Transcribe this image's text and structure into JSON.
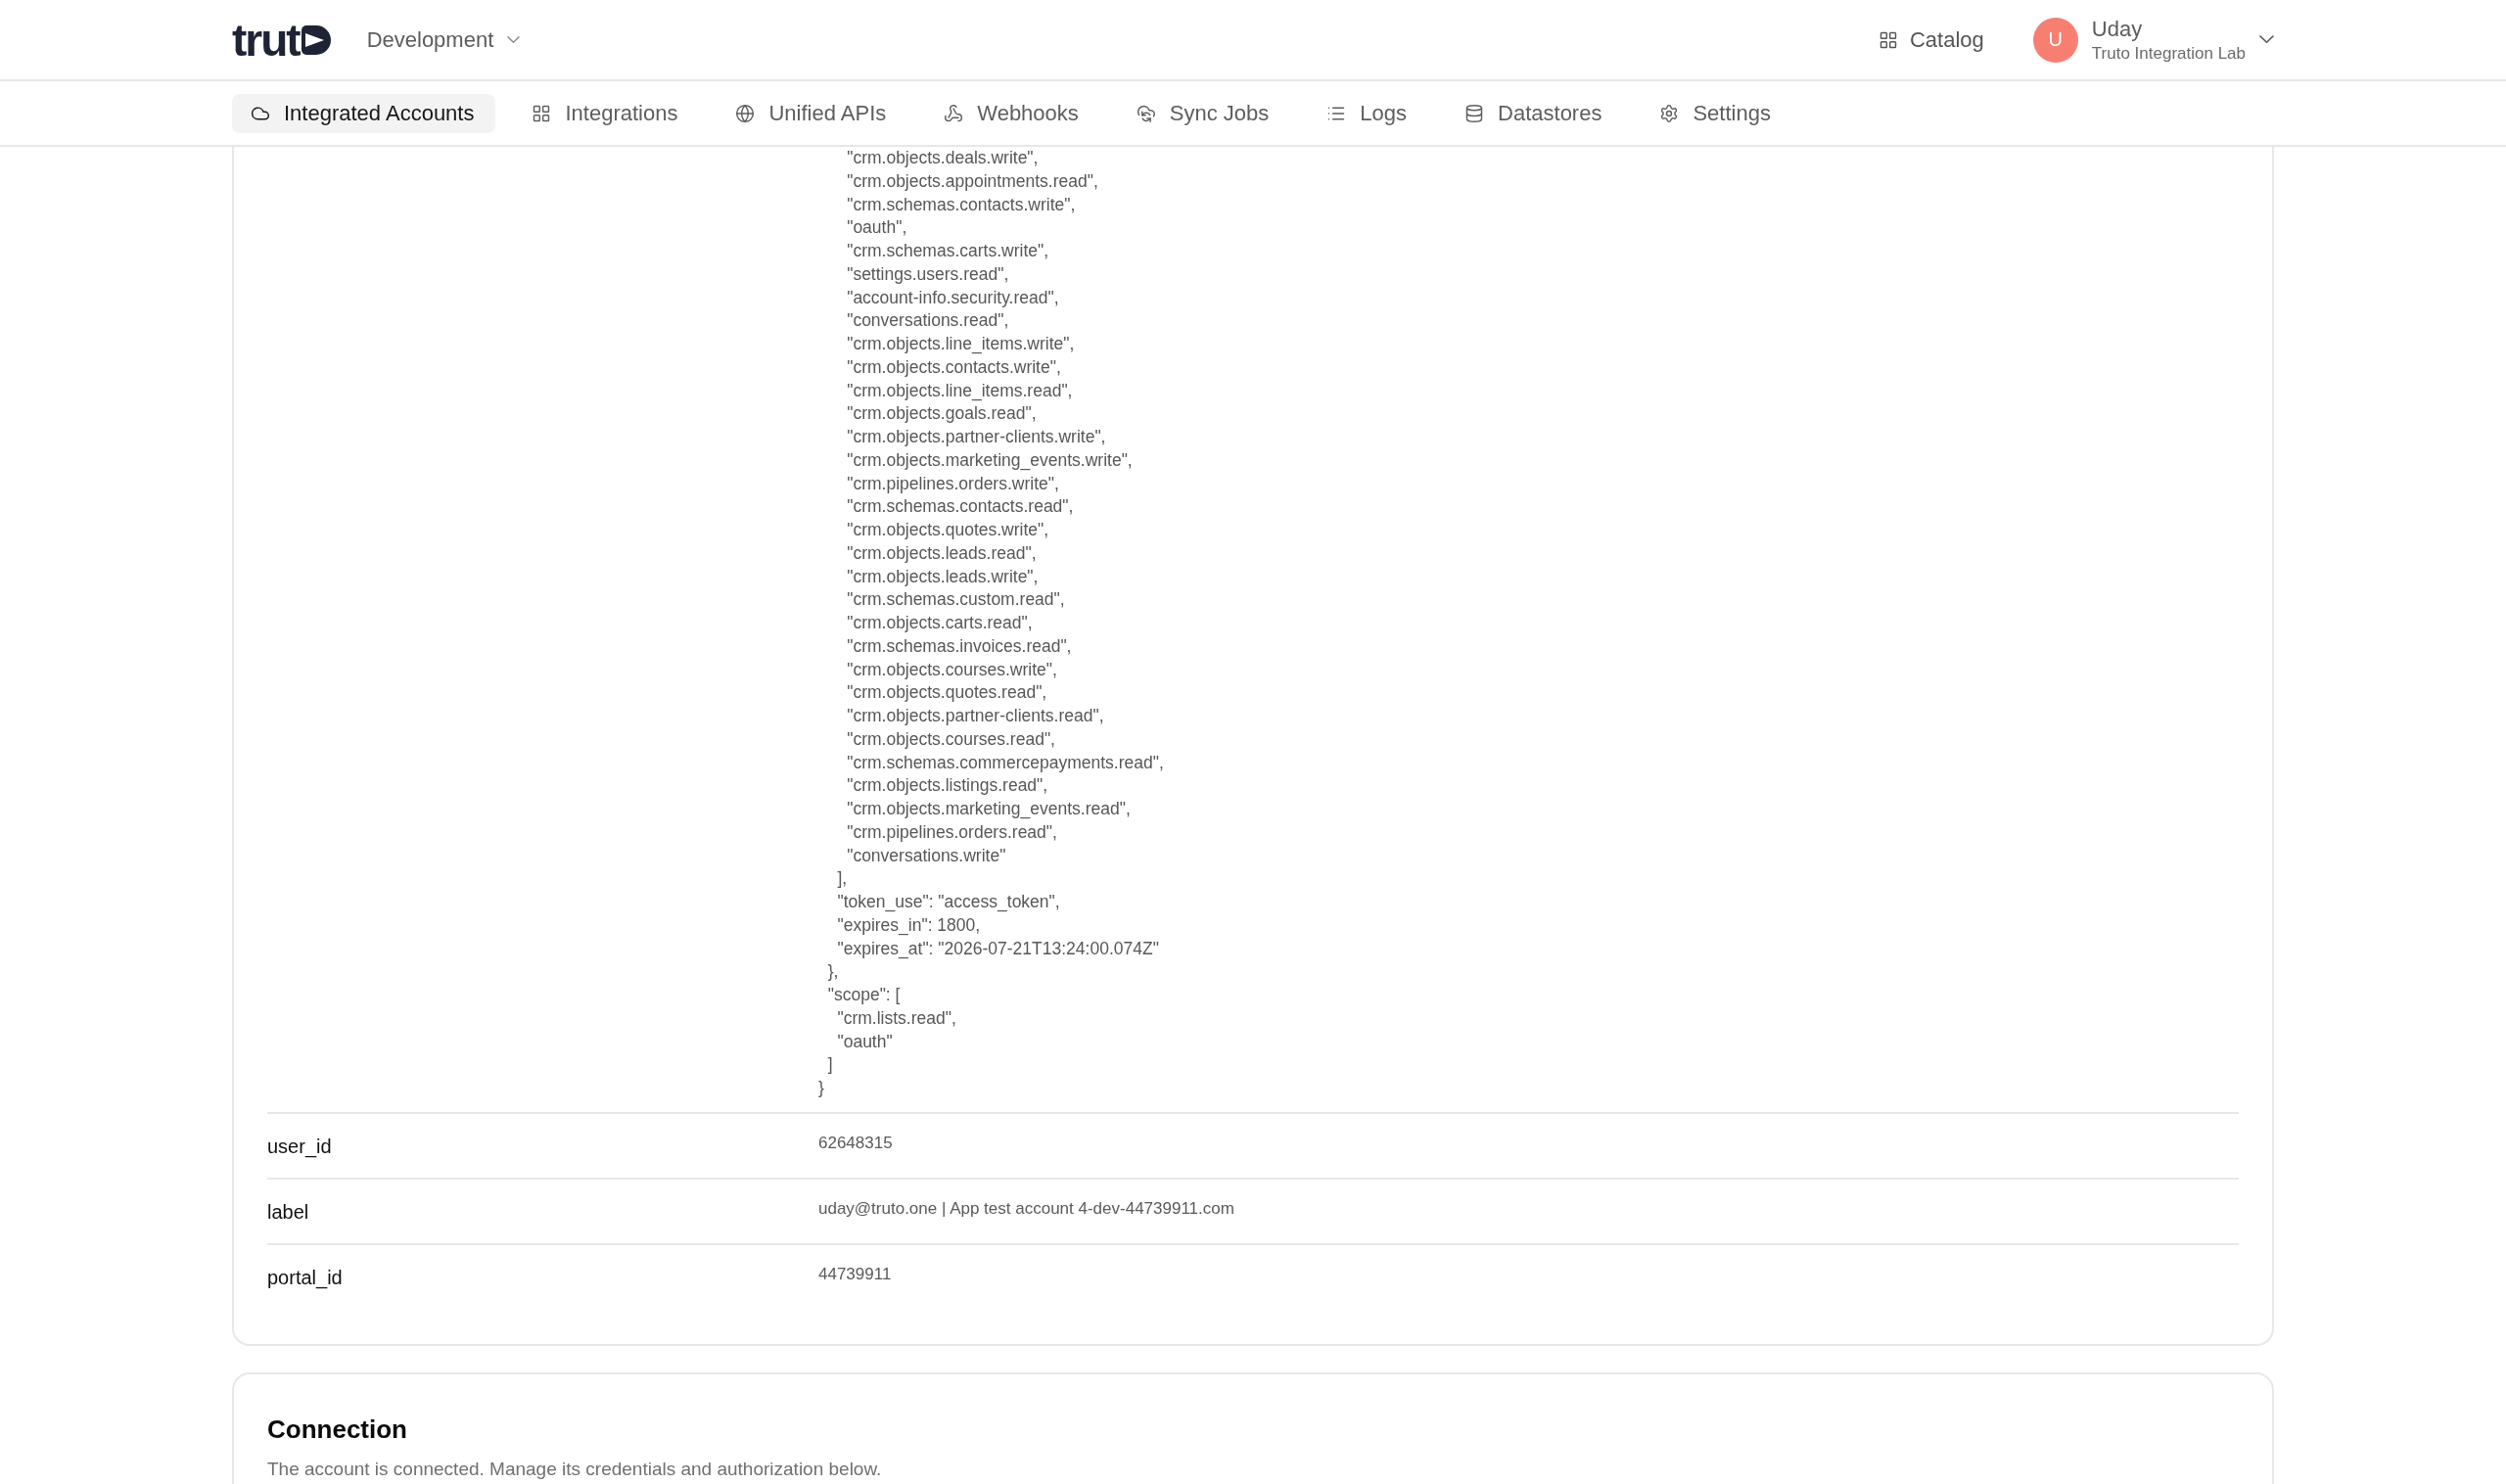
{
  "header": {
    "logo": "trut",
    "environment": "Development",
    "catalog": "Catalog",
    "user": {
      "initial": "U",
      "name": "Uday",
      "organization": "Truto Integration Lab"
    }
  },
  "nav_tabs": [
    {
      "label": "Integrated Accounts",
      "selected": true
    },
    {
      "label": "Integrations",
      "selected": false
    },
    {
      "label": "Unified APIs",
      "selected": false
    },
    {
      "label": "Webhooks",
      "selected": false
    },
    {
      "label": "Sync Jobs",
      "selected": false
    },
    {
      "label": "Logs",
      "selected": false
    },
    {
      "label": "Datastores",
      "selected": false
    },
    {
      "label": "Settings",
      "selected": false
    }
  ],
  "details_card": {
    "rows": [
      {
        "kind": "code",
        "lines": [
          "      \"crm.objects.deals.write\",",
          "      \"crm.objects.appointments.read\",",
          "      \"crm.schemas.contacts.write\",",
          "      \"oauth\",",
          "      \"crm.schemas.carts.write\",",
          "      \"settings.users.read\",",
          "      \"account-info.security.read\",",
          "      \"conversations.read\",",
          "      \"crm.objects.line_items.write\",",
          "      \"crm.objects.contacts.write\",",
          "      \"crm.objects.line_items.read\",",
          "      \"crm.objects.goals.read\",",
          "      \"crm.objects.partner-clients.write\",",
          "      \"crm.objects.marketing_events.write\",",
          "      \"crm.pipelines.orders.write\",",
          "      \"crm.schemas.contacts.read\",",
          "      \"crm.objects.quotes.write\",",
          "      \"crm.objects.leads.read\",",
          "      \"crm.objects.leads.write\",",
          "      \"crm.schemas.custom.read\",",
          "      \"crm.objects.carts.read\",",
          "      \"crm.schemas.invoices.read\",",
          "      \"crm.objects.courses.write\",",
          "      \"crm.objects.quotes.read\",",
          "      \"crm.objects.partner-clients.read\",",
          "      \"crm.objects.courses.read\",",
          "      \"crm.schemas.commercepayments.read\",",
          "      \"crm.objects.listings.read\",",
          "      \"crm.objects.marketing_events.read\",",
          "      \"crm.pipelines.orders.read\",",
          "      \"conversations.write\"",
          "    ],",
          "    \"token_use\": \"access_token\",",
          "    \"expires_in\": 1800,",
          "    \"expires_at\": \"2026-07-21T13:24:00.074Z\"",
          "  },",
          "  \"scope\": [",
          "    \"crm.lists.read\",",
          "    \"oauth\"",
          "  ]",
          "}"
        ]
      },
      {
        "kind": "field",
        "key": "user_id",
        "value": "62648315"
      },
      {
        "kind": "field",
        "key": "label",
        "value": "uday@truto.one | App test account 4-dev-44739911.com"
      },
      {
        "kind": "field",
        "key": "portal_id",
        "value": "44739911"
      }
    ]
  },
  "connection_card": {
    "title": "Connection",
    "description": "The account is connected. Manage its credentials and authorization below."
  }
}
